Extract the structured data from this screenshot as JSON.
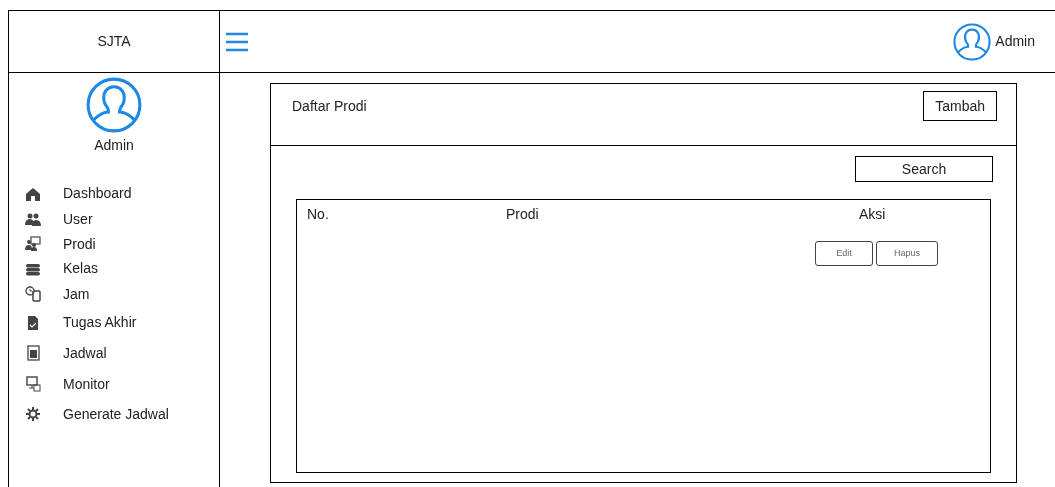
{
  "brand": "SJTA",
  "header": {
    "user": "Admin"
  },
  "sidebar": {
    "user": "Admin",
    "items": [
      {
        "label": "Dashboard"
      },
      {
        "label": "User"
      },
      {
        "label": "Prodi"
      },
      {
        "label": "Kelas"
      },
      {
        "label": "Jam"
      },
      {
        "label": "Tugas Akhir"
      },
      {
        "label": "Jadwal"
      },
      {
        "label": "Monitor"
      },
      {
        "label": "Generate Jadwal"
      }
    ]
  },
  "panel": {
    "title": "Daftar Prodi",
    "add_button": "Tambah",
    "search_button": "Search",
    "table": {
      "columns": [
        "No.",
        "Prodi",
        "Aksi"
      ],
      "actions": [
        "Edit",
        "Hapus"
      ]
    }
  }
}
